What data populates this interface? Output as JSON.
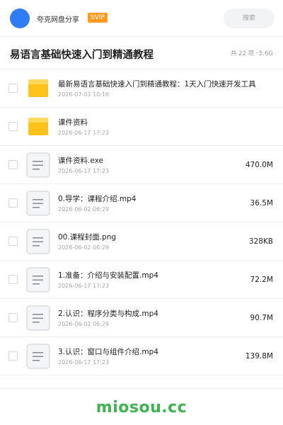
{
  "header": {
    "username": "夸克网盘分享",
    "badge": "SVIP",
    "search_placeholder": "搜索",
    "avatar_color": "#2f7cf6",
    "badge_color": "#ff9a1f"
  },
  "title": {
    "text": "易语言基础快速入门到精通教程",
    "count": "共 22 项",
    "separator": "·",
    "size": "5.6G"
  },
  "files": [
    {
      "type": "folder",
      "icon": "folder-icon",
      "name": "最新易语言基础快速入门到精通教程：1天入门快速开发工具",
      "date": "2026-07-03 10:16",
      "size": ""
    },
    {
      "type": "folder",
      "icon": "folder-icon",
      "name": "课件资料",
      "date": "2026-06-17 17:23",
      "size": ""
    },
    {
      "type": "file",
      "icon": "document-icon",
      "name": "课件资料.exe",
      "date": "2026-06-17 17:23",
      "size": "470.0M"
    },
    {
      "type": "file",
      "icon": "document-icon",
      "name": "0.导学：课程介绍.mp4",
      "date": "2026-06-02 06:29",
      "size": "36.5M"
    },
    {
      "type": "file",
      "icon": "document-icon",
      "name": "00.课程封面.png",
      "date": "2026-06-02 06:29",
      "size": "328KB"
    },
    {
      "type": "file",
      "icon": "document-icon",
      "name": "1.准备：介绍与安装配置.mp4",
      "date": "2026-06-17 17:23",
      "size": "72.2M"
    },
    {
      "type": "file",
      "icon": "document-icon",
      "name": "2.认识：程序分类与构成.mp4",
      "date": "2026-06-02 06:29",
      "size": "90.7M"
    },
    {
      "type": "file",
      "icon": "document-icon",
      "name": "3.认识：窗口与组件介绍.mp4",
      "date": "2026-06-17 17:23",
      "size": "139.8M"
    }
  ],
  "footer": {
    "watermark": "miosou.cc",
    "watermark_color": "#3fb34f"
  }
}
